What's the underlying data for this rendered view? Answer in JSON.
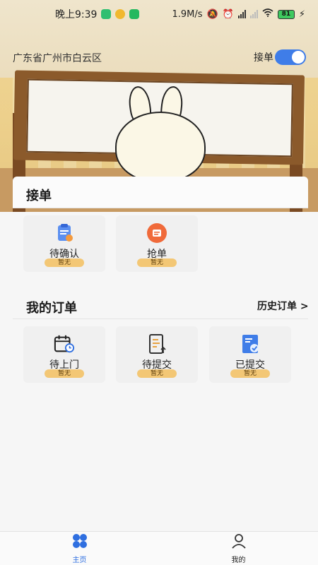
{
  "status_bar": {
    "time": "晚上9:39",
    "network_speed": "1.9M/s",
    "battery": "81"
  },
  "header": {
    "location": "广东省广州市白云区",
    "toggle_label": "接单",
    "toggle_on": true
  },
  "accept_section": {
    "title": "接单",
    "tiles": [
      {
        "label": "待确认",
        "badge": "暂无",
        "icon": "clipboard-icon"
      },
      {
        "label": "抢单",
        "badge": "暂无",
        "icon": "grab-order-icon"
      }
    ]
  },
  "orders_section": {
    "title": "我的订单",
    "history_link": "历史订单 >",
    "tiles": [
      {
        "label": "待上门",
        "badge": "暂无",
        "icon": "calendar-clock-icon"
      },
      {
        "label": "待提交",
        "badge": "暂无",
        "icon": "document-upload-icon"
      },
      {
        "label": "已提交",
        "badge": "暂无",
        "icon": "document-check-icon"
      }
    ]
  },
  "bottom_nav": {
    "items": [
      {
        "label": "主页",
        "icon": "home-grid-icon",
        "active": true
      },
      {
        "label": "我的",
        "icon": "person-icon",
        "active": false
      }
    ]
  },
  "colors": {
    "accent": "#2f6fe0",
    "toggle": "#3f7de8",
    "badge": "#f3c775"
  }
}
